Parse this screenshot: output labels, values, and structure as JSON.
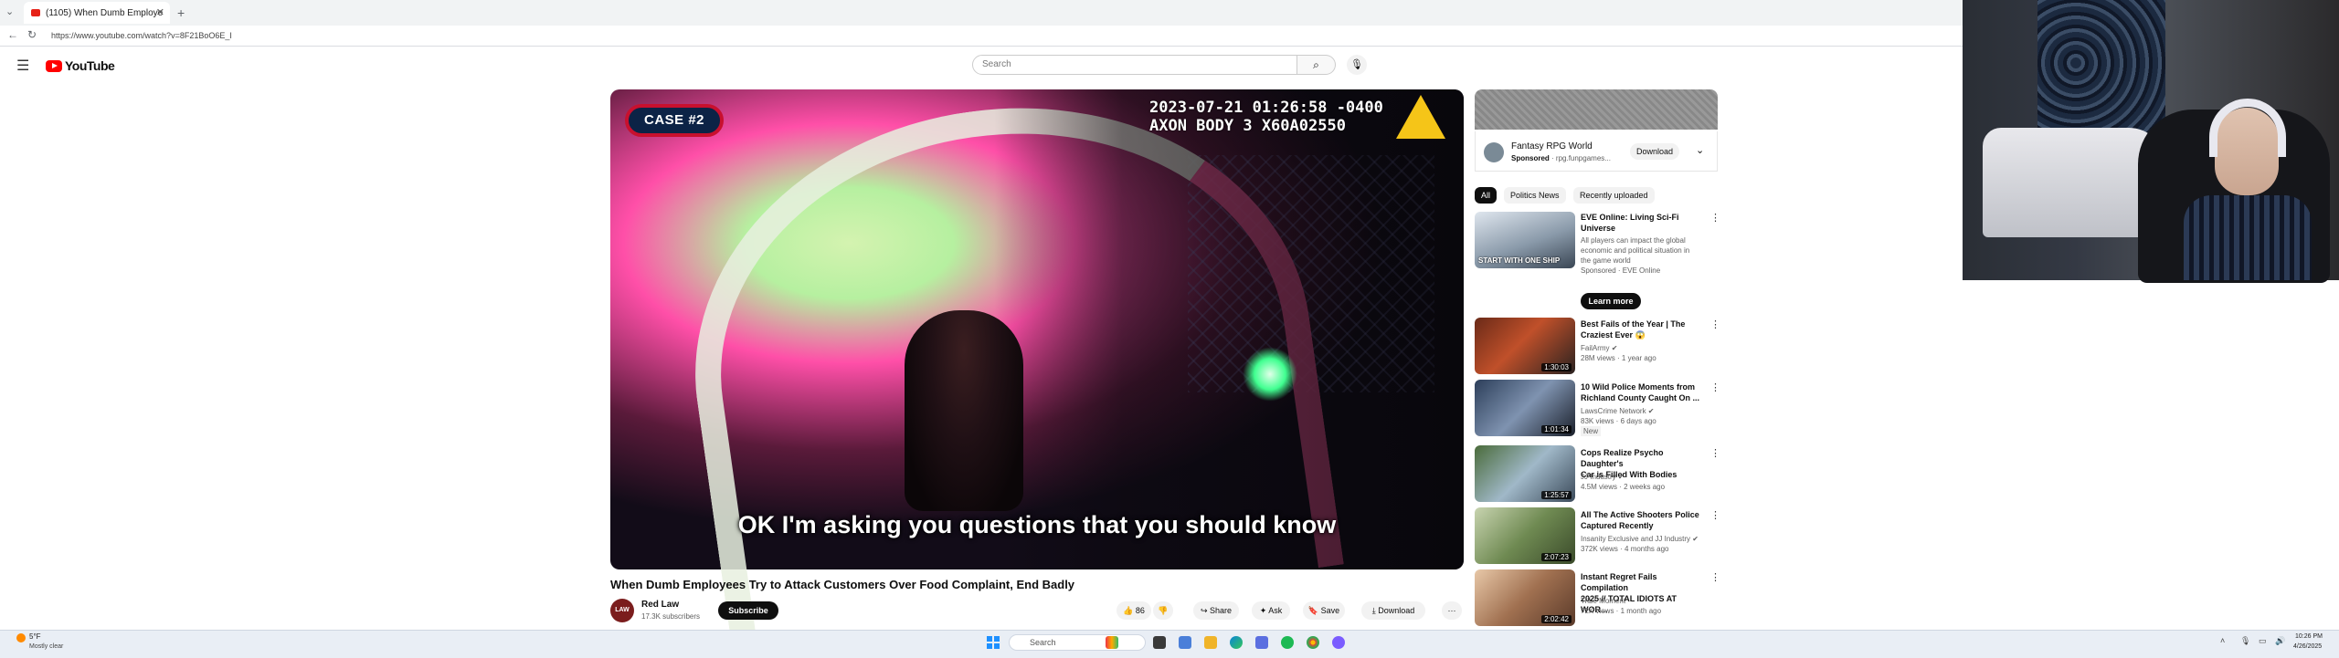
{
  "browser": {
    "tab_title": "(1105) When Dumb Employe",
    "url": "https://www.youtube.com/watch?v=8F21BoO6E_I"
  },
  "youtube": {
    "logo_text": "YouTube",
    "search_placeholder": "Search"
  },
  "video": {
    "case_badge": "CASE #2",
    "timestamp_line1": "2023-07-21 01:26:58 -0400",
    "timestamp_line2": "AXON BODY 3 X60A02550",
    "subtitle": "OK I'm asking you questions that you should know",
    "title": "When Dumb Employees Try to Attack Customers Over Food Complaint, End Badly",
    "channel_avatar_text": "LAW",
    "channel_name": "Red Law",
    "channel_subs": "17.3K subscribers",
    "subscribe_label": "Subscribe",
    "like_count": "86",
    "share_label": "Share",
    "ask_label": "Ask",
    "save_label": "Save",
    "download_label": "Download",
    "more_label": "···"
  },
  "ad": {
    "title": "Fantasy RPG World",
    "sponsored": "Sponsored",
    "domain": "· rpg.funpgames...",
    "download_label": "Download"
  },
  "chips": [
    "All",
    "Politics News",
    "Recently uploaded"
  ],
  "recommendations": [
    {
      "title_lines": [
        "EVE Online: Living Sci-Fi",
        "Universe"
      ],
      "meta": [
        "All players can impact the global",
        "economic and political situation in",
        "the game world",
        "Sponsored · EVE Online"
      ],
      "duration": "",
      "thumb_text": "START WITH ONE SHIP",
      "cta": "Learn more"
    },
    {
      "title_lines": [
        "Best Fails of the Year | The",
        "Craziest Ever 😱"
      ],
      "meta": [
        "FailArmy ✔",
        "28M views · 1 year ago"
      ],
      "duration": "1:30:03"
    },
    {
      "title_lines": [
        "10 Wild Police Moments from",
        "Richland County Caught On ..."
      ],
      "meta": [
        "LawsCrime Network ✔",
        "83K views · 6 days ago",
        "New"
      ],
      "duration": "1:01:34"
    },
    {
      "title_lines": [
        "Cops Realize Psycho Daughter's",
        "Car is Filled With Bodies"
      ],
      "meta": [
        "JJ Industry ✔",
        "4.5M views · 2 weeks ago"
      ],
      "duration": "1:25:57"
    },
    {
      "title_lines": [
        "All The Active Shooters Police",
        "Captured Recently"
      ],
      "meta": [
        "Insanity Exclusive and JJ Industry ✔",
        "372K views · 4 months ago"
      ],
      "duration": "2:07:23"
    },
    {
      "title_lines": [
        "Instant Regret Fails Compilation",
        "2025 // TOTAL IDIOTS AT WOR..."
      ],
      "meta": [
        "Tribe Moment",
        "72K views · 1 month ago"
      ],
      "duration": "2:02:42"
    }
  ],
  "taskbar": {
    "weather_temp": "5°F",
    "weather_desc": "Mostly clear",
    "search_placeholder": "Search",
    "time": "10:26 PM",
    "date": "4/26/2025"
  },
  "colors": {
    "youtube_red": "#ff0000",
    "case_badge_border": "#c8102e",
    "case_badge_fill": "#0c2346",
    "axon_yellow": "#f5c518"
  }
}
